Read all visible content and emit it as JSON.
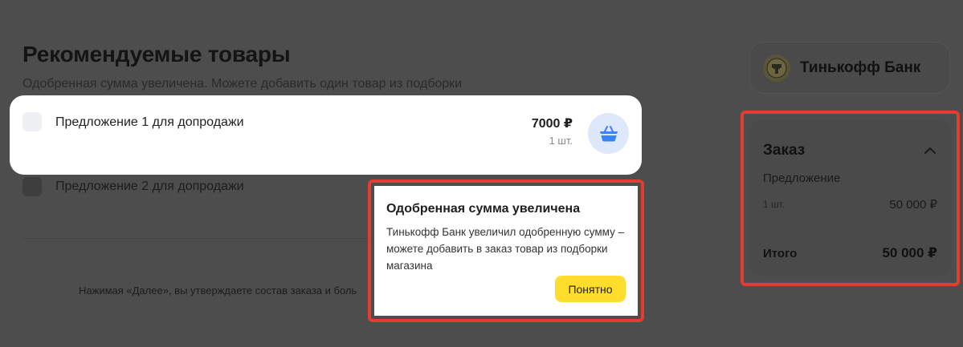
{
  "recommendations": {
    "title": "Рекомендуемые товары",
    "subtitle": "Одобренная сумма увеличена. Можете добавить один товар из подборки",
    "offers": [
      {
        "label": "Предложение 1 для допродажи",
        "price": "7000 ₽",
        "qty": "1 шт.",
        "icon": "basket-icon"
      },
      {
        "label": "Предложение 2 для допродажи"
      }
    ]
  },
  "footer_note": "Нажимая «Далее», вы утверждаете состав заказа и боль",
  "popup": {
    "title": "Одобренная сумма увеличена",
    "body": "Тинькофф Банк увеличил одобренную сумму – можете добавить в заказ товар из подборки магазина",
    "button": "Понятно"
  },
  "bank": {
    "name": "Тинькофф Банк",
    "logo_icon": "bank-emblem-icon"
  },
  "order": {
    "title": "Заказ",
    "item": "Предложение",
    "qty": "1 шт.",
    "item_price": "50 000 ₽",
    "total_label": "Итого",
    "total_value": "50 000 ₽"
  },
  "colors": {
    "accent_yellow": "#ffdd2d",
    "highlight_red": "#e53b30",
    "basket_blue": "#3b82f6",
    "overlay": "#4d4d4d"
  }
}
